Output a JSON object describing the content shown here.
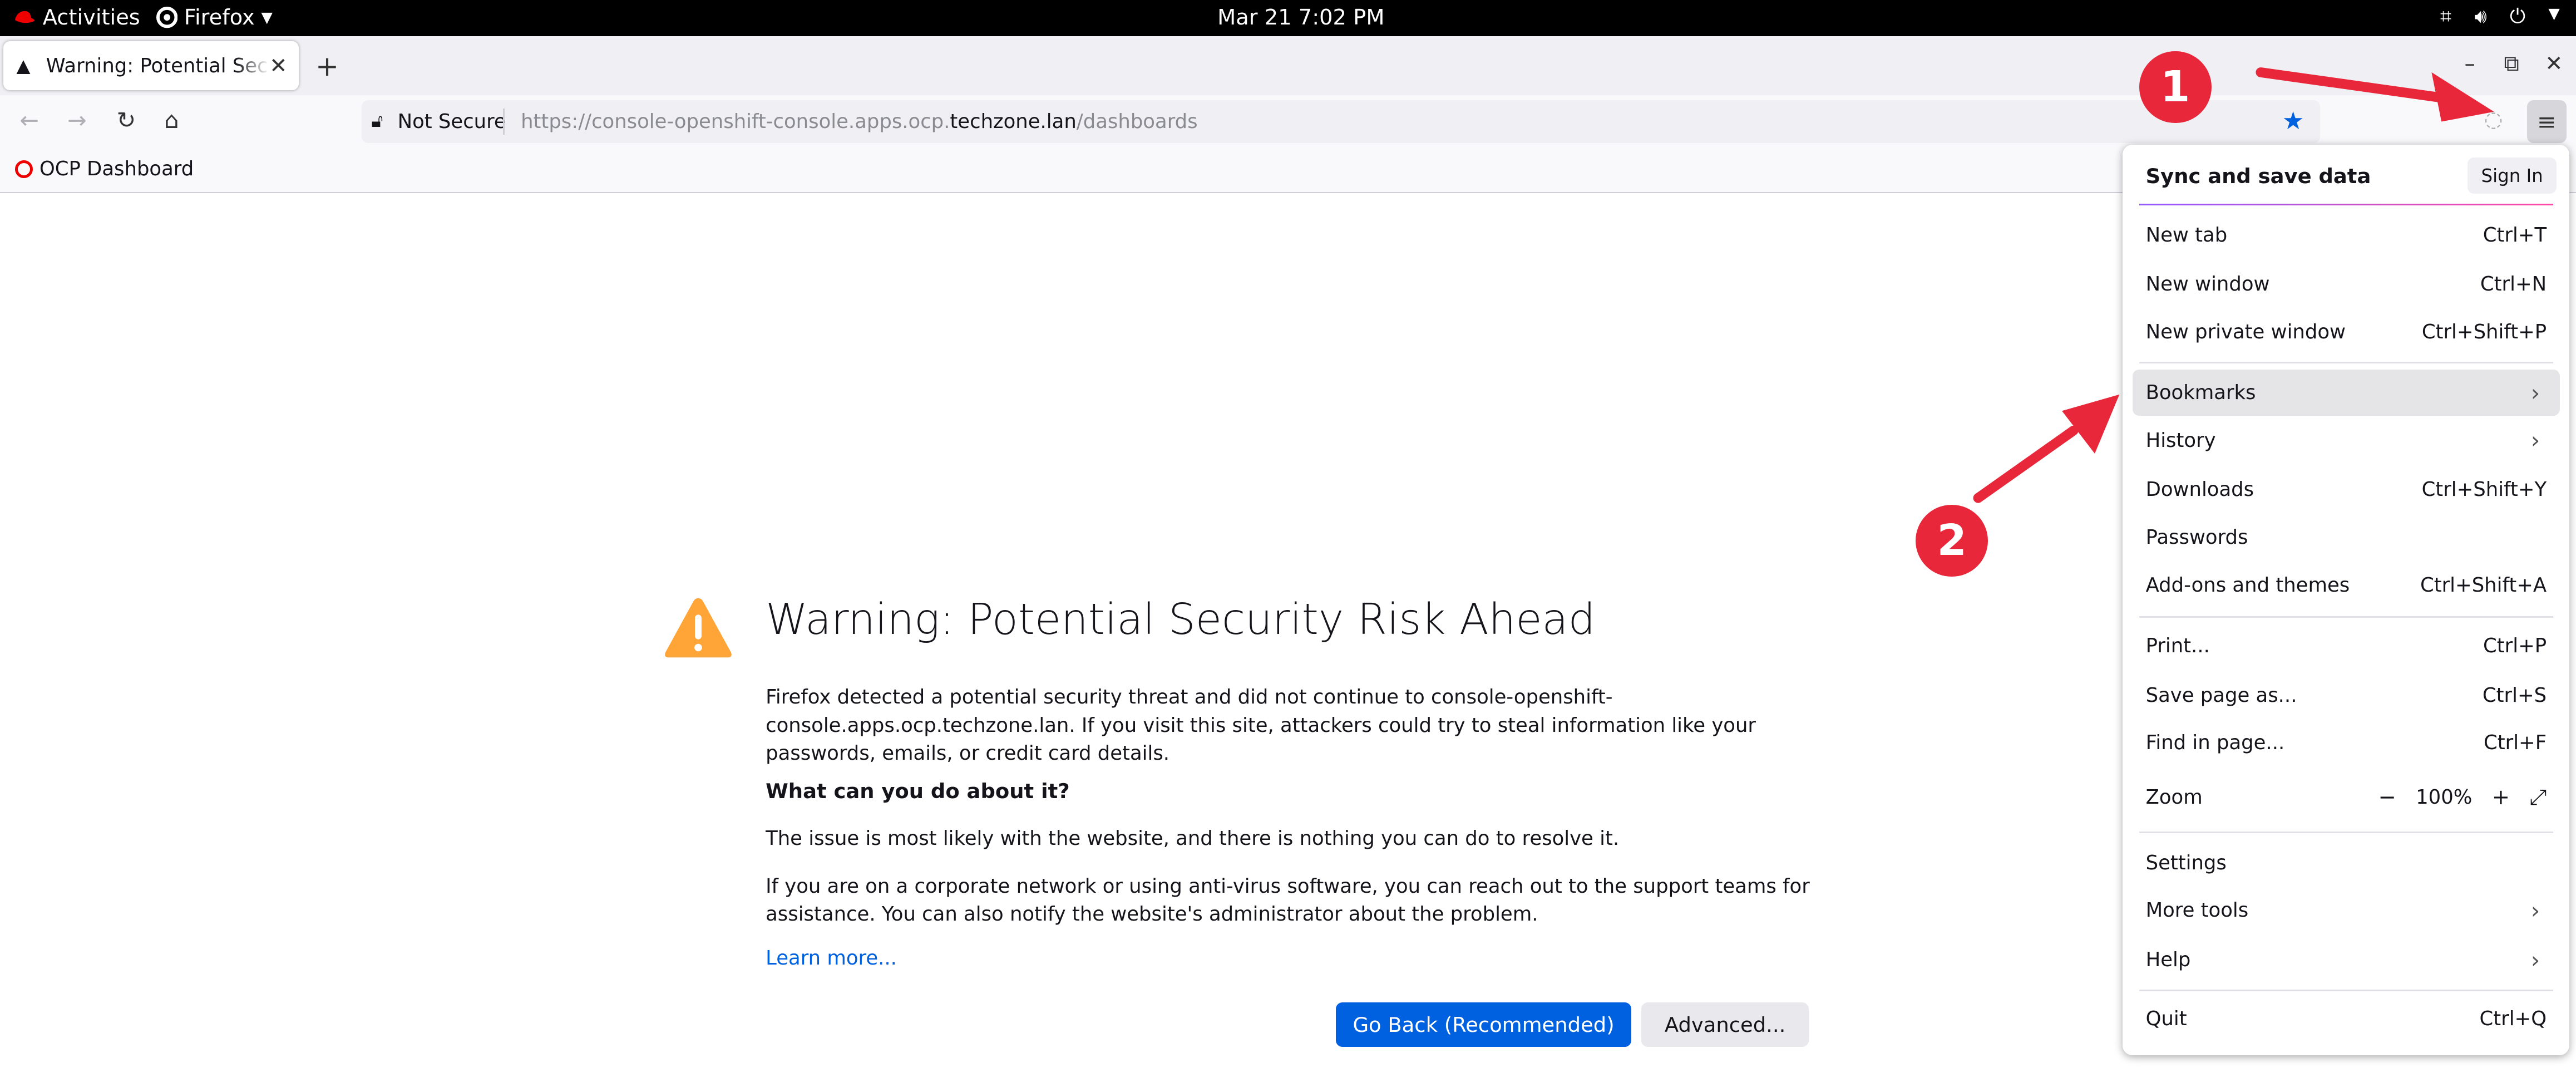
{
  "topbar": {
    "activities": "Activities",
    "app_name": "Firefox",
    "datetime": "Mar 21  7:02 PM"
  },
  "tab": {
    "title": "Warning: Potential Security Risk Ahead"
  },
  "navbar": {
    "security_label": "Not Secure",
    "url_prefix": "https://console-openshift-console.apps.ocp.",
    "url_domain": "techzone.lan",
    "url_path": "/dashboards"
  },
  "bookmarks_toolbar": {
    "items": [
      {
        "label": "OCP Dashboard"
      }
    ]
  },
  "error_page": {
    "title": "Warning: Potential Security Risk Ahead",
    "intro": "Firefox detected a potential security threat and did not continue to console-openshift-console.apps.ocp.techzone.lan. If you visit this site, attackers could try to steal information like your passwords, emails, or credit card details.",
    "what_heading": "What can you do about it?",
    "issue_text": "The issue is most likely with the website, and there is nothing you can do to resolve it.",
    "corporate_text": "If you are on a corporate network or using anti-virus software, you can reach out to the support teams for assistance. You can also notify the website's administrator about the problem.",
    "learn_more": "Learn more...",
    "go_back_button": "Go Back (Recommended)",
    "advanced_button": "Advanced..."
  },
  "app_menu": {
    "sync_title": "Sync and save data",
    "sign_in": "Sign In",
    "items": [
      {
        "label": "New tab",
        "shortcut": "Ctrl+T"
      },
      {
        "label": "New window",
        "shortcut": "Ctrl+N"
      },
      {
        "label": "New private window",
        "shortcut": "Ctrl+Shift+P"
      },
      {
        "label": "Bookmarks",
        "shortcut": ""
      },
      {
        "label": "History",
        "shortcut": ""
      },
      {
        "label": "Downloads",
        "shortcut": "Ctrl+Shift+Y"
      },
      {
        "label": "Passwords",
        "shortcut": ""
      },
      {
        "label": "Add-ons and themes",
        "shortcut": "Ctrl+Shift+A"
      },
      {
        "label": "Print...",
        "shortcut": "Ctrl+P"
      },
      {
        "label": "Save page as...",
        "shortcut": "Ctrl+S"
      },
      {
        "label": "Find in page...",
        "shortcut": "Ctrl+F"
      },
      {
        "label": "Zoom",
        "shortcut": ""
      },
      {
        "label": "Settings",
        "shortcut": ""
      },
      {
        "label": "More tools",
        "shortcut": ""
      },
      {
        "label": "Help",
        "shortcut": ""
      },
      {
        "label": "Quit",
        "shortcut": "Ctrl+Q"
      }
    ],
    "zoom_value": "100%",
    "zoom_minus": "−",
    "zoom_plus": "+"
  },
  "annotations": {
    "badge_1": "1",
    "badge_2": "2"
  },
  "colors": {
    "accent_blue": "#0061e0",
    "warning_orange": "#ffa436",
    "annotation_red": "#e8283a"
  },
  "icons": [
    "redhat-icon",
    "firefox-icon",
    "chevron-down-icon",
    "network-icon",
    "volume-icon",
    "power-icon",
    "warning-icon",
    "close-icon",
    "plus-icon",
    "minimize-icon",
    "restore-icon",
    "back-icon",
    "forward-icon",
    "reload-icon",
    "home-icon",
    "lock-icon",
    "star-icon",
    "pocket-icon",
    "hamburger-icon",
    "chevron-right-icon",
    "expand-icon"
  ]
}
